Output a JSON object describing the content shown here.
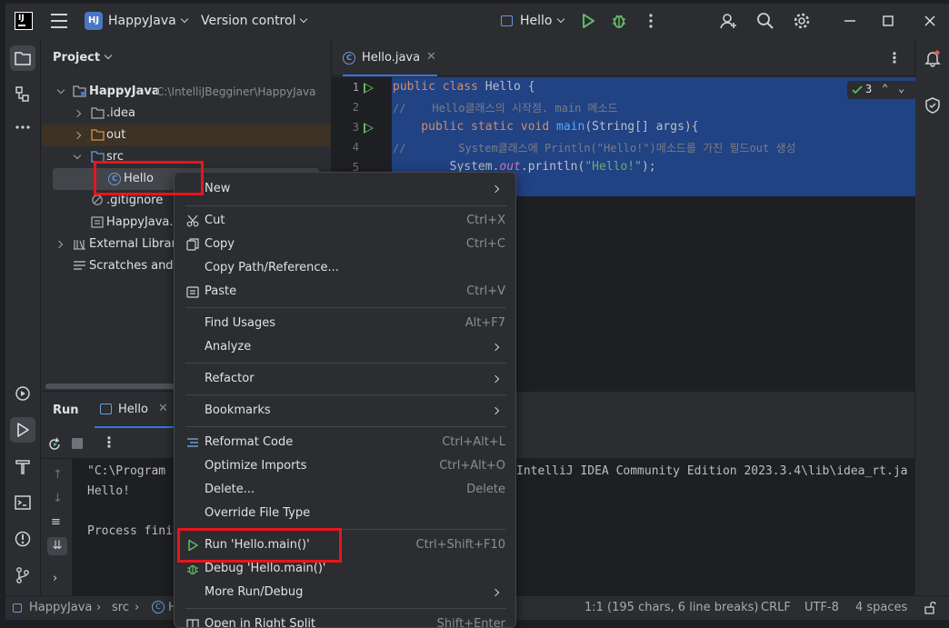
{
  "titlebar": {
    "logo": "IJ",
    "project_badge": "HJ",
    "project": "HappyJava",
    "vcs": "Version control",
    "run_config": "Hello"
  },
  "project_panel": {
    "title": "Project",
    "tree": [
      {
        "label": "HappyJava",
        "hint": "C:\\IntelliJBegginer\\HappyJava"
      },
      {
        "label": ".idea"
      },
      {
        "label": "out"
      },
      {
        "label": "src"
      },
      {
        "label": "Hello"
      },
      {
        "label": ".gitignore"
      },
      {
        "label": "HappyJava.i"
      },
      {
        "label": "External Librari"
      },
      {
        "label": "Scratches and"
      }
    ]
  },
  "editor": {
    "tab": "Hello.java",
    "inspections": "3",
    "line_numbers": [
      "1",
      "2",
      "3",
      "4",
      "5"
    ],
    "code": [
      {
        "p1": "public class ",
        "p2": "Hello {"
      },
      {
        "p1": "//    ",
        "p2": "Hello클래스의 시작점. main 메소드"
      },
      {
        "p1": "    public static void ",
        "p2": "main",
        "p3": "(String[] args){"
      },
      {
        "p1": "//        ",
        "p2": "System클래스에 Println(\"Hello!\")메소드를 가진 필드out 생성"
      },
      {
        "p1": "        System.",
        "p2": "out",
        "p3": ".println(",
        "p4": "\"Hello!\"",
        "p5": ");"
      }
    ]
  },
  "run_panel": {
    "title": "Run",
    "tab": "Hello",
    "console": [
      "\"C:\\Program",
      "Hello!",
      "",
      "Process fini"
    ],
    "console_right": "IntelliJ IDEA Community Edition 2023.3.4\\lib\\idea_rt.ja"
  },
  "status": {
    "crumbs": [
      "HappyJava",
      "src",
      "H"
    ],
    "position": "1:1 (195 chars, 6 line breaks)",
    "line_sep": "CRLF",
    "encoding": "UTF-8",
    "indent": "4 spaces"
  },
  "context_menu": {
    "items": [
      {
        "label": "New",
        "shortcut": ""
      },
      {
        "label": "Cut",
        "shortcut": "Ctrl+X"
      },
      {
        "label": "Copy",
        "shortcut": "Ctrl+C"
      },
      {
        "label": "Copy Path/Reference...",
        "shortcut": ""
      },
      {
        "label": "Paste",
        "shortcut": "Ctrl+V"
      },
      {
        "label": "Find Usages",
        "shortcut": "Alt+F7"
      },
      {
        "label": "Analyze",
        "shortcut": ""
      },
      {
        "label": "Refactor",
        "shortcut": ""
      },
      {
        "label": "Bookmarks",
        "shortcut": ""
      },
      {
        "label": "Reformat Code",
        "shortcut": "Ctrl+Alt+L"
      },
      {
        "label": "Optimize Imports",
        "shortcut": "Ctrl+Alt+O"
      },
      {
        "label": "Delete...",
        "shortcut": "Delete"
      },
      {
        "label": "Override File Type",
        "shortcut": ""
      },
      {
        "label": "Run 'Hello.main()'",
        "shortcut": "Ctrl+Shift+F10"
      },
      {
        "label": "Debug 'Hello.main()'",
        "shortcut": ""
      },
      {
        "label": "More Run/Debug",
        "shortcut": ""
      },
      {
        "label": "Open in Right Split",
        "shortcut": "Shift+Enter"
      }
    ]
  },
  "colors": {
    "highlight": "#e8151d",
    "selection": "#214283",
    "run_green": "#5fb865"
  }
}
